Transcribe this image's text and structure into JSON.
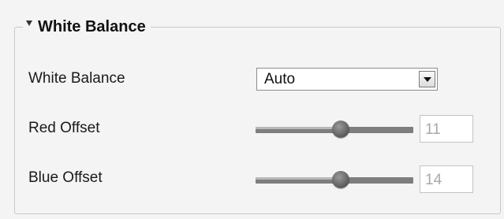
{
  "section": {
    "title": "White Balance"
  },
  "white_balance": {
    "label": "White Balance",
    "selected": "Auto"
  },
  "red_offset": {
    "label": "Red Offset",
    "value": "11",
    "slider_fraction": 0.54
  },
  "blue_offset": {
    "label": "Blue Offset",
    "value": "14",
    "slider_fraction": 0.54
  }
}
